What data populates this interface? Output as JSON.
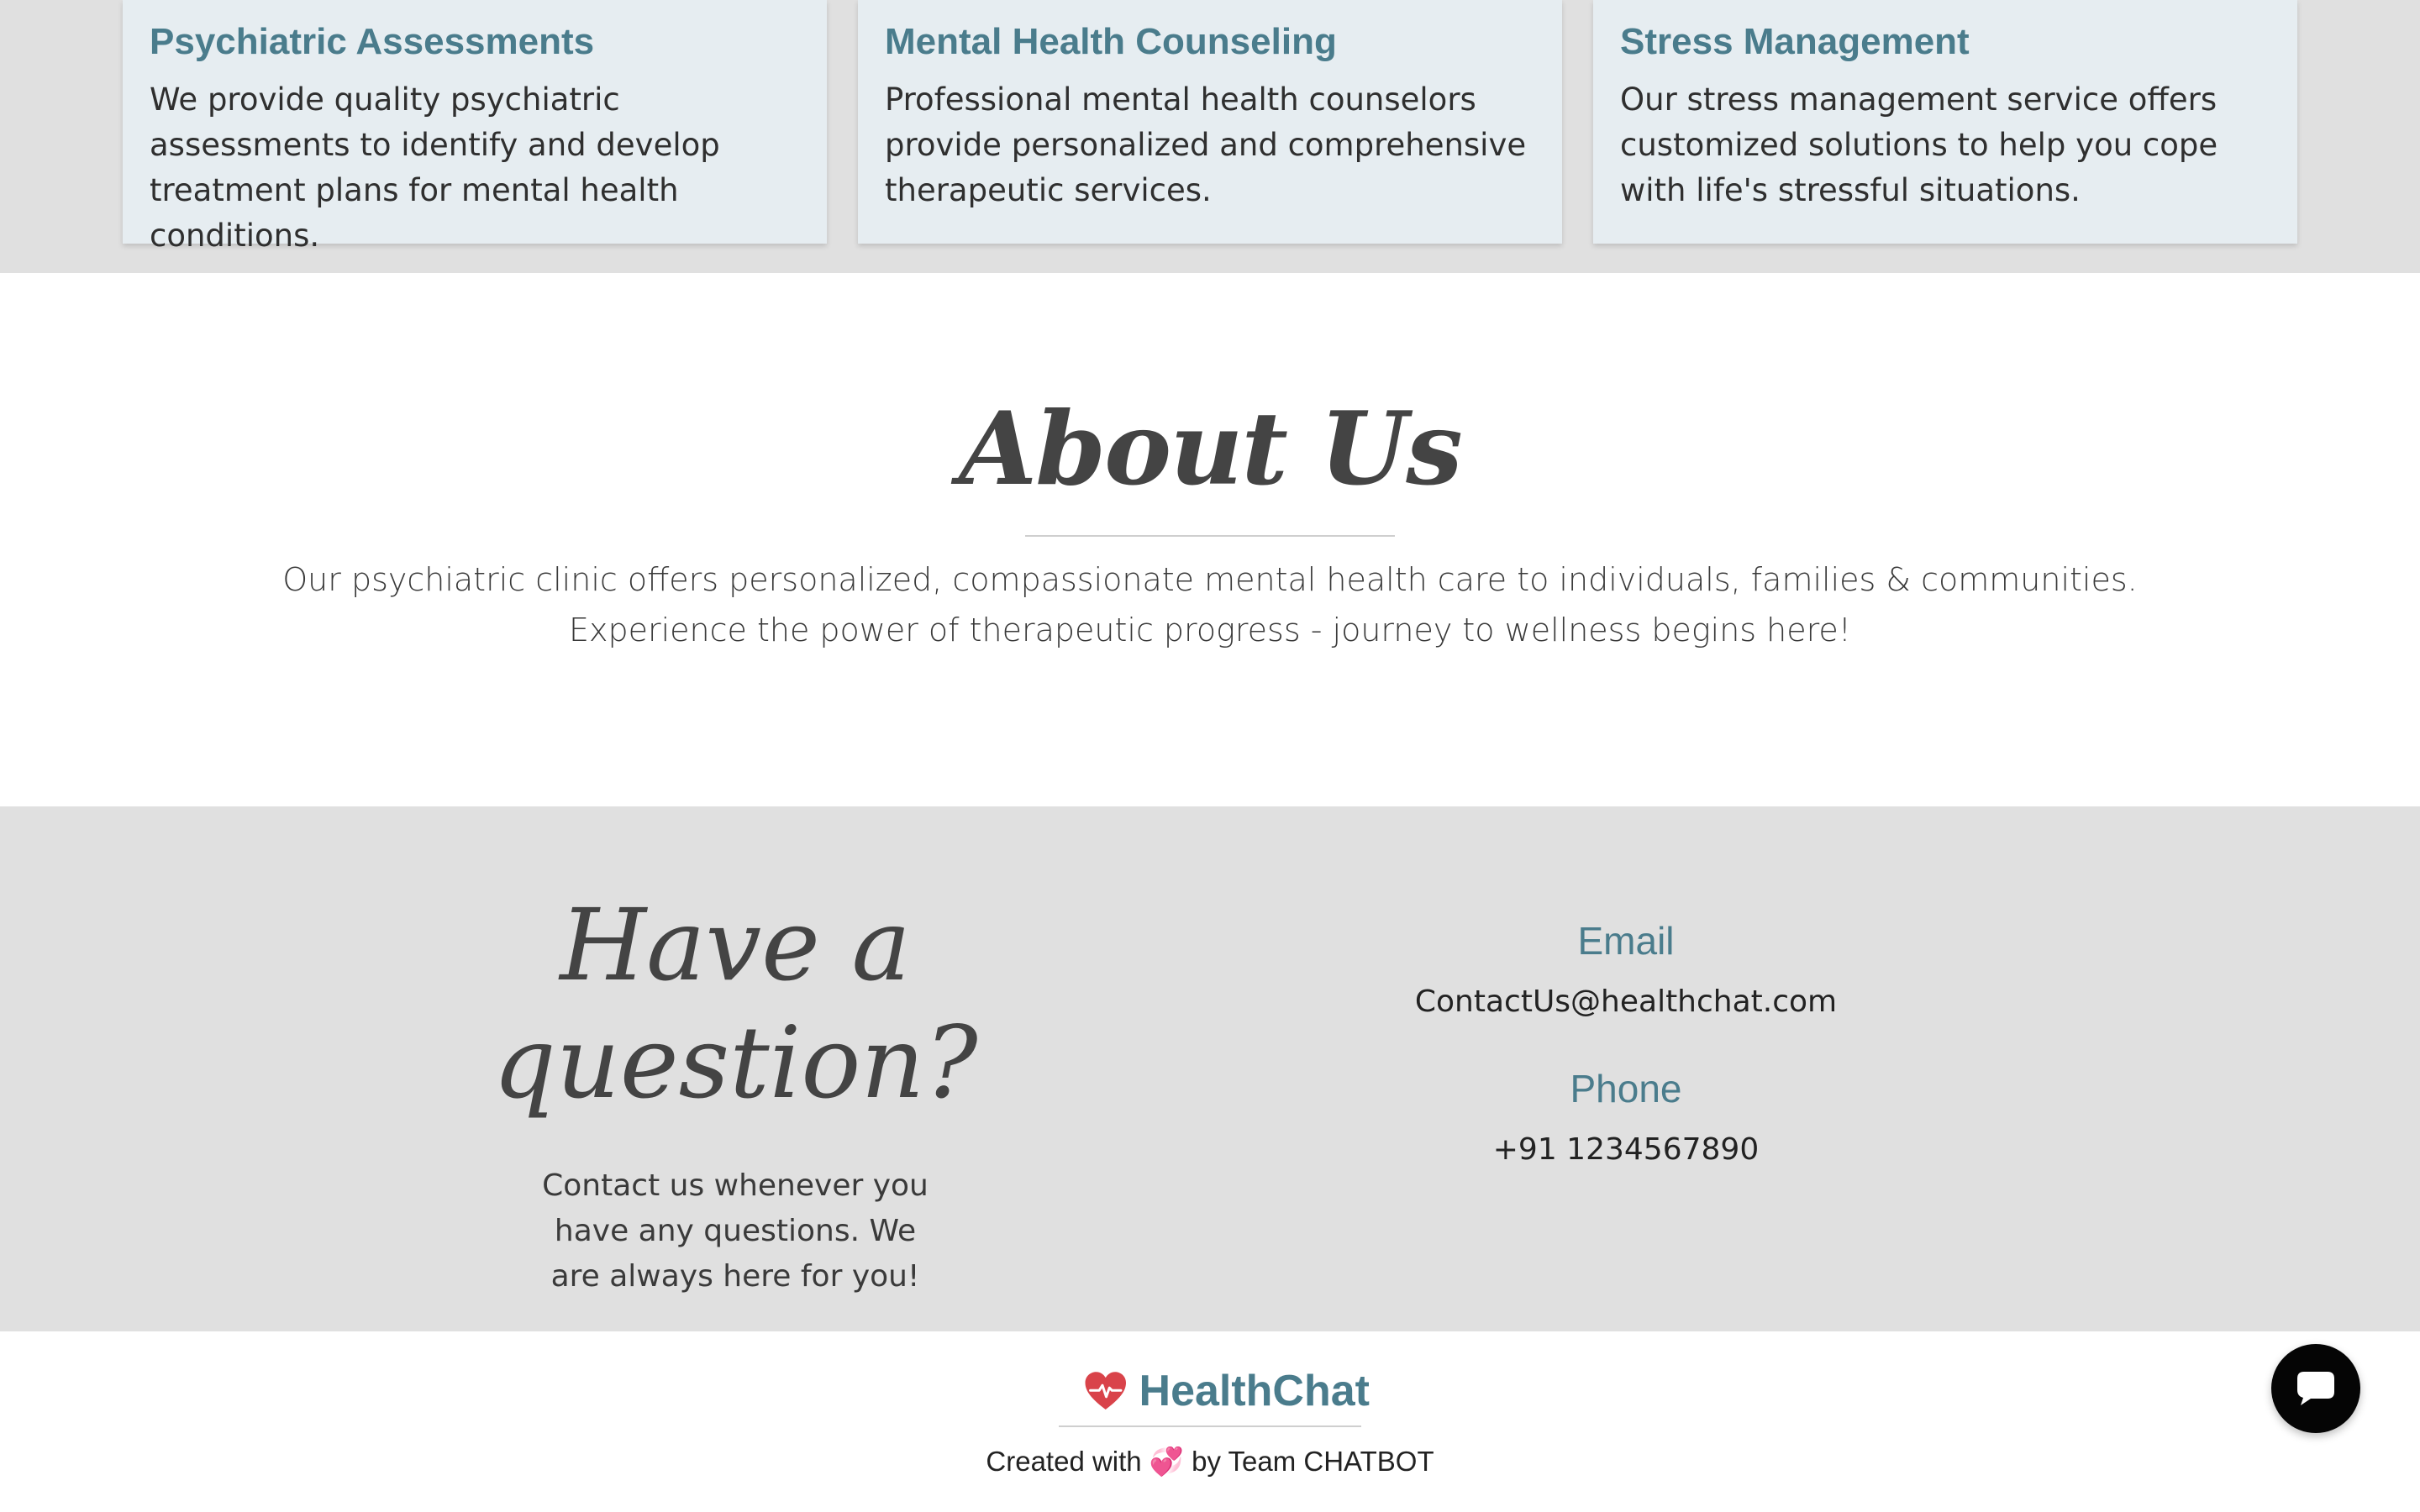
{
  "services": [
    {
      "title": "Psychiatric Assessments",
      "text": "We provide quality psychiatric assessments to identify and develop treatment plans for mental health conditions."
    },
    {
      "title": "Mental Health Counseling",
      "text": "Professional mental health counselors provide personalized and comprehensive therapeutic services."
    },
    {
      "title": "Stress Management",
      "text": "Our stress management service offers customized solutions to help you cope with life's stressful situations."
    }
  ],
  "about": {
    "title": "About Us",
    "line1": "Our psychiatric clinic offers personalized, compassionate mental health care to individuals, families & communities.",
    "line2": "Experience the power of therapeutic progress - journey to wellness begins here!"
  },
  "contact": {
    "heading": "Have a question?",
    "text": "Contact us whenever you have any questions. We are always here for you!",
    "email_label": "Email",
    "email": "ContactUs@healthchat.com",
    "phone_label": "Phone",
    "phone": "+91 1234567890"
  },
  "footer": {
    "brand": "HealthChat",
    "credit_before": "Created with",
    "credit_emoji": "💞",
    "credit_after": "by Team CHATBOT"
  },
  "colors": {
    "accent": "#4a7c8c",
    "heart": "#d9434a",
    "band": "#e0e0e0",
    "card": "#e6edf1"
  },
  "icons": {
    "brand_logo": "heart-pulse-icon",
    "chat_button": "chat-bubble-icon"
  }
}
